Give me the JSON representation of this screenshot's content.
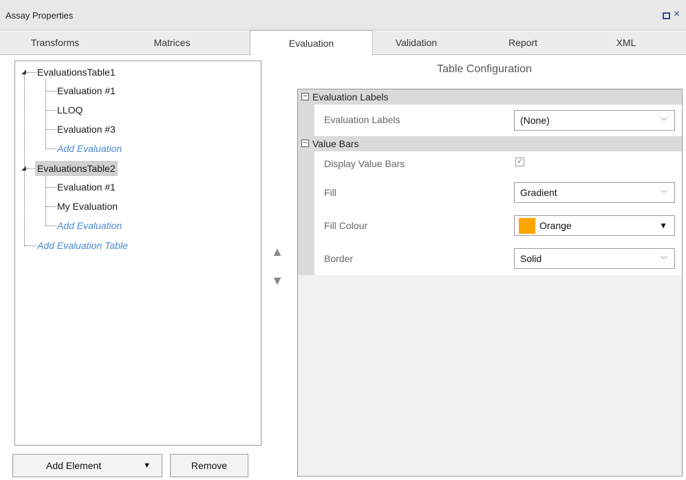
{
  "window": {
    "title": "Assay Properties"
  },
  "tabs": [
    {
      "label": "Transforms"
    },
    {
      "label": "Matrices"
    },
    {
      "label": "Evaluation"
    },
    {
      "label": "Validation"
    },
    {
      "label": "Report"
    },
    {
      "label": "XML"
    }
  ],
  "active_tab": "Evaluation",
  "tree": {
    "table1": {
      "label": "EvaluationsTable1",
      "children": [
        "Evaluation #1",
        "LLOQ",
        "Evaluation #3"
      ],
      "add_label": "Add Evaluation"
    },
    "table2": {
      "label": "EvaluationsTable2",
      "children": [
        "Evaluation #1",
        "My Evaluation"
      ],
      "add_label": "Add Evaluation"
    },
    "add_table_label": "Add Evaluation Table"
  },
  "buttons": {
    "add_element": "Add Element",
    "remove": "Remove"
  },
  "move": {
    "up": "▲",
    "down": "▼"
  },
  "config": {
    "title": "Table Configuration",
    "cat_evaluation_labels": "Evaluation Labels",
    "evaluation_labels": {
      "label": "Evaluation Labels",
      "value": "(None)"
    },
    "cat_value_bars": "Value Bars",
    "display_value_bars": {
      "label": "Display Value Bars",
      "checked": true
    },
    "fill": {
      "label": "Fill",
      "value": "Gradient"
    },
    "fill_colour": {
      "label": "Fill Colour",
      "value": "Orange",
      "swatch": "#ffa500"
    },
    "border": {
      "label": "Border",
      "value": "Solid"
    }
  },
  "colors": {
    "link": "#4a86d6",
    "selected_bg": "#d0d0d0",
    "category_bg": "#dadada"
  }
}
